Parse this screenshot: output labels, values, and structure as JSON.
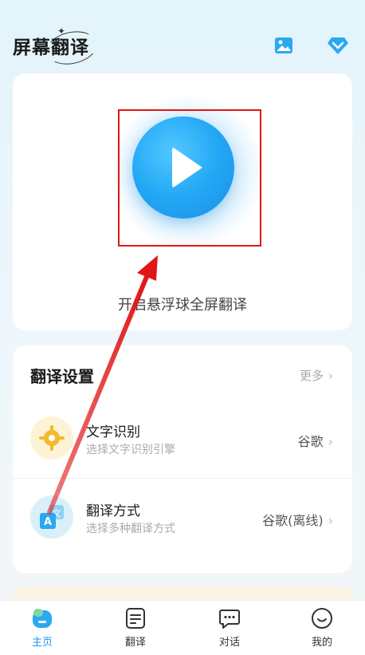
{
  "header": {
    "title": "屏幕翻译",
    "icons": [
      "image-icon",
      "diamond-vip-icon"
    ]
  },
  "main_card": {
    "icon": "play-icon",
    "label": "开启悬浮球全屏翻译"
  },
  "settings": {
    "title": "翻译设置",
    "more_label": "更多",
    "rows": [
      {
        "icon": "ocr-target-icon",
        "title": "文字识别",
        "subtitle": "选择文字识别引擎",
        "value": "谷歌"
      },
      {
        "icon": "translate-icon",
        "title": "翻译方式",
        "subtitle": "选择多种翻译方式",
        "value": "谷歌(离线)"
      }
    ]
  },
  "tabbar": {
    "tabs": [
      {
        "label": "主页",
        "icon": "home-icon",
        "active": true
      },
      {
        "label": "翻译",
        "icon": "document-icon",
        "active": false
      },
      {
        "label": "对话",
        "icon": "chat-icon",
        "active": false
      },
      {
        "label": "我的",
        "icon": "smiley-profile-icon",
        "active": false
      }
    ]
  },
  "colors": {
    "accent": "#2196f3",
    "annotation_red": "#e01515",
    "play_blue": "#23a8f5"
  }
}
